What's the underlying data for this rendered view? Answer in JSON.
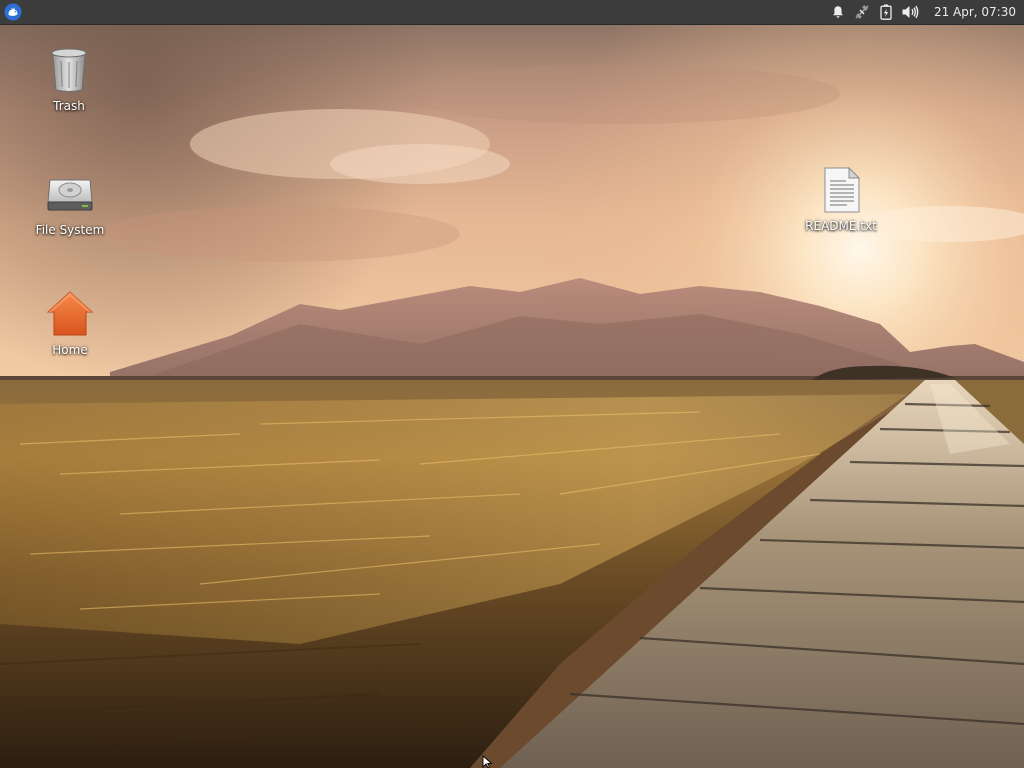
{
  "panel": {
    "menu_icon": "xfce-mouse-icon",
    "tray": {
      "notifications_icon": "bell-icon",
      "network_icon": "network-disconnected-icon",
      "battery_icon": "battery-charging-icon",
      "volume_icon": "speaker-volume-icon"
    },
    "clock": "21 Apr, 07:30"
  },
  "desktop": {
    "icons": [
      {
        "label": "Trash",
        "icon": "trash-icon"
      },
      {
        "label": "File System",
        "icon": "hard-drive-icon"
      },
      {
        "label": "Home",
        "icon": "home-folder-icon"
      },
      {
        "label": "README.txt",
        "icon": "text-file-icon"
      }
    ]
  },
  "colors": {
    "panel_bg": "#3c3c3c",
    "panel_text": "#ececec",
    "menu_accent": "#2d6fd6",
    "home_icon": "#e8672d"
  }
}
